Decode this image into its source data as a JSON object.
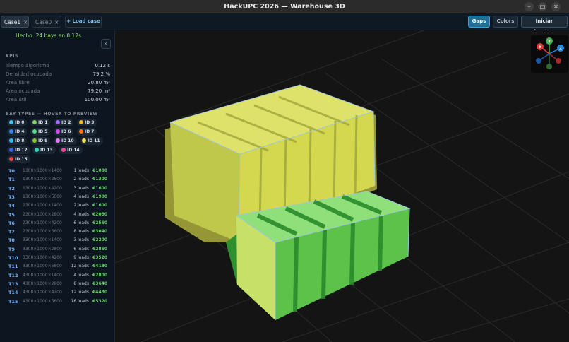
{
  "window": {
    "title": "HackUPC 2026 — Warehouse 3D"
  },
  "tabs": [
    {
      "label": "Case1",
      "close": "×",
      "active": true
    },
    {
      "label": "Case0",
      "close": "×",
      "active": false
    }
  ],
  "toolbar": {
    "load_case": "+ Load case",
    "gaps": "Gaps",
    "colors": "Colors",
    "run": "Iniciar algoritmo"
  },
  "panel": {
    "status": "Hecho: 24 bays en 0.12s",
    "collapse": "‹",
    "kpis_title": "KPIS",
    "kpis": [
      {
        "label": "Tiempo algoritmo",
        "value": "0.12 s"
      },
      {
        "label": "Densidad ocupada",
        "value": "79.2 %"
      },
      {
        "label": "Area libre",
        "value": "20.80 m²"
      },
      {
        "label": "Area ocupada",
        "value": "79.20 m²"
      },
      {
        "label": "Area útil",
        "value": "100.00 m²"
      }
    ],
    "bay_types_title": "BAY TYPES — HOVER TO PREVIEW",
    "bay_ids": [
      {
        "label": "ID 0",
        "color": "#36c5f0"
      },
      {
        "label": "ID 1",
        "color": "#7ed957"
      },
      {
        "label": "ID 2",
        "color": "#a066ff"
      },
      {
        "label": "ID 3",
        "color": "#f0b429"
      },
      {
        "label": "ID 4",
        "color": "#3b82f6"
      },
      {
        "label": "ID 5",
        "color": "#4ade80"
      },
      {
        "label": "ID 6",
        "color": "#d946ef"
      },
      {
        "label": "ID 7",
        "color": "#f97316"
      },
      {
        "label": "ID 8",
        "color": "#38bdf8"
      },
      {
        "label": "ID 9",
        "color": "#84cc16"
      },
      {
        "label": "ID 10",
        "color": "#e879f9"
      },
      {
        "label": "ID 11",
        "color": "#fde047"
      },
      {
        "label": "ID 12",
        "color": "#3b5bdb"
      },
      {
        "label": "ID 13",
        "color": "#2dd4bf"
      },
      {
        "label": "ID 14",
        "color": "#ec4899"
      },
      {
        "label": "ID 15",
        "color": "#ef4444"
      }
    ],
    "types": [
      {
        "id": "T0",
        "dims": "1300×1000×1400",
        "loads": "1 loads",
        "price": "€1000"
      },
      {
        "id": "T1",
        "dims": "1300×1000×2800",
        "loads": "2 loads",
        "price": "€1300"
      },
      {
        "id": "T2",
        "dims": "1300×1000×4200",
        "loads": "3 loads",
        "price": "€1600"
      },
      {
        "id": "T3",
        "dims": "1300×1000×5600",
        "loads": "4 loads",
        "price": "€1900"
      },
      {
        "id": "T4",
        "dims": "2300×1000×1400",
        "loads": "2 loads",
        "price": "€1600"
      },
      {
        "id": "T5",
        "dims": "2300×1000×2800",
        "loads": "4 loads",
        "price": "€2080"
      },
      {
        "id": "T6",
        "dims": "2300×1000×4200",
        "loads": "6 loads",
        "price": "€2560"
      },
      {
        "id": "T7",
        "dims": "2300×1000×5600",
        "loads": "8 loads",
        "price": "€3040"
      },
      {
        "id": "T8",
        "dims": "3300×1000×1400",
        "loads": "3 loads",
        "price": "€2200"
      },
      {
        "id": "T9",
        "dims": "3300×1000×2800",
        "loads": "6 loads",
        "price": "€2860"
      },
      {
        "id": "T10",
        "dims": "3300×1000×4200",
        "loads": "9 loads",
        "price": "€3520"
      },
      {
        "id": "T11",
        "dims": "3300×1000×5600",
        "loads": "12 loads",
        "price": "€4180"
      },
      {
        "id": "T12",
        "dims": "4300×1000×1400",
        "loads": "4 loads",
        "price": "€2800"
      },
      {
        "id": "T13",
        "dims": "4300×1000×2800",
        "loads": "8 loads",
        "price": "€3640"
      },
      {
        "id": "T14",
        "dims": "4300×1000×4200",
        "loads": "12 loads",
        "price": "€4480"
      },
      {
        "id": "T15",
        "dims": "4300×1000×5600",
        "loads": "16 loads",
        "price": "€5320"
      }
    ]
  },
  "gizmo": {
    "axes": [
      {
        "label": "Y",
        "color": "#4caf50"
      },
      {
        "label": "X",
        "color": "#e53935"
      },
      {
        "label": "Z",
        "color": "#1e88e5"
      }
    ]
  },
  "colors": {
    "upper_block": "#d8dd5a",
    "lower_block": "#3aa83a",
    "accent_button": "#1f6f94"
  }
}
